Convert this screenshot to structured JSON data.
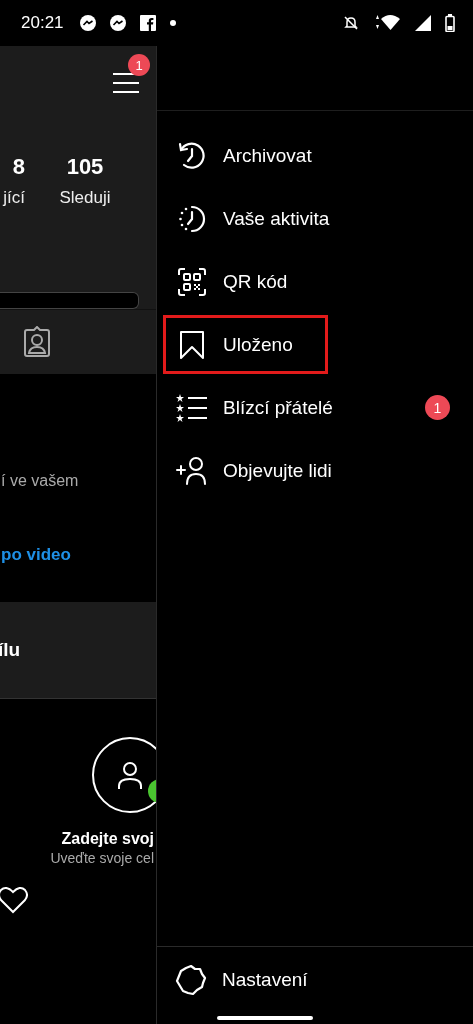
{
  "status_bar": {
    "time": "20:21"
  },
  "profile": {
    "menu_badge": "1",
    "stats": [
      {
        "value": "8",
        "label": "jící"
      },
      {
        "value": "105",
        "label": "Sleduji"
      }
    ],
    "empty_text": "í ve vašem",
    "empty_link": "po video",
    "card_title": "ílu",
    "suggestion_title": "Zadejte svoj",
    "suggestion_text": "Uveďte svoje cel"
  },
  "drawer": {
    "items": [
      {
        "kind": "archive",
        "label": "Archivovat",
        "highlighted": false
      },
      {
        "kind": "activity",
        "label": "Vaše aktivita",
        "highlighted": false
      },
      {
        "kind": "qr",
        "label": "QR kód",
        "highlighted": false
      },
      {
        "kind": "saved",
        "label": "Uloženo",
        "highlighted": true
      },
      {
        "kind": "close_friends",
        "label": "Blízcí přátelé",
        "highlighted": false,
        "badge": "1"
      },
      {
        "kind": "discover",
        "label": "Objevujte lidi",
        "highlighted": false
      }
    ],
    "settings": {
      "label": "Nastavení"
    }
  }
}
